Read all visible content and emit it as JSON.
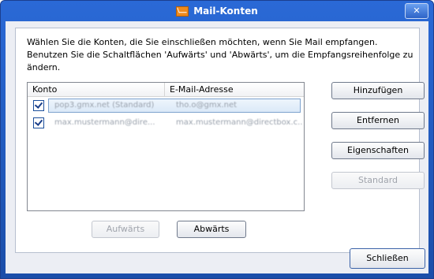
{
  "window": {
    "title": "Mail-Konten",
    "app_icon": "mail-envelope-icon",
    "close_glyph": "✕"
  },
  "instructions": "Wählen Sie die Konten, die Sie einschließen möchten, wenn Sie Mail empfangen. Benutzen Sie die Schaltflächen 'Aufwärts' und 'Abwärts', um die Empfangsreihenfolge zu ändern.",
  "accounts_list": {
    "columns": [
      "Konto",
      "E-Mail-Adresse"
    ],
    "rows": [
      {
        "checked": true,
        "account": "pop3.gmx.net (Standard)",
        "email": "tho.o@gmx.net",
        "selected": true
      },
      {
        "checked": true,
        "account": "max.mustermann@dire...",
        "email": "max.mustermann@directbox.c...",
        "selected": false
      }
    ]
  },
  "buttons": {
    "add": "Hinzufügen",
    "remove": "Entfernen",
    "properties": "Eigenschaften",
    "set_default": "Standard",
    "move_up": "Aufwärts",
    "move_down": "Abwärts",
    "close": "Schließen"
  },
  "state": {
    "set_default_enabled": false,
    "move_up_enabled": false
  }
}
